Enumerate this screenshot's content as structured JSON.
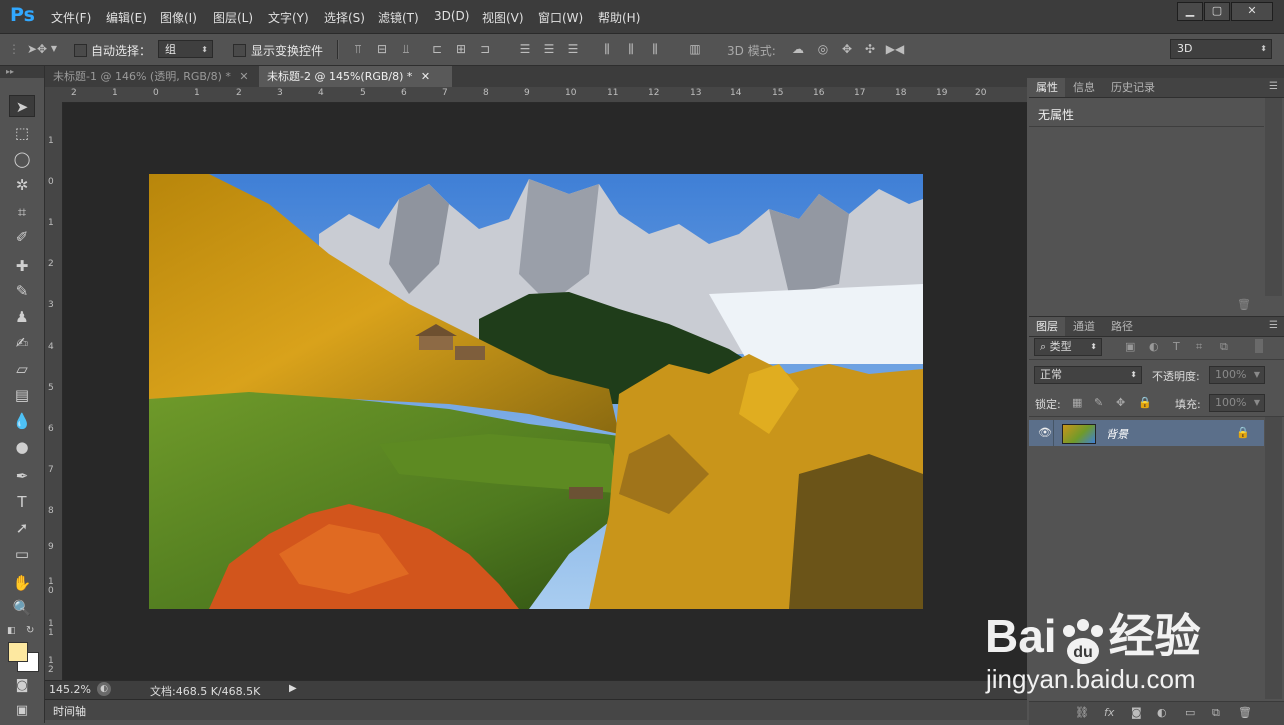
{
  "app": {
    "logo": "Ps",
    "menus": [
      "文件(F)",
      "编辑(E)",
      "图像(I)",
      "图层(L)",
      "文字(Y)",
      "选择(S)",
      "滤镜(T)",
      "3D(D)",
      "视图(V)",
      "窗口(W)",
      "帮助(H)"
    ],
    "window_controls": [
      "minimize-icon",
      "maximize-icon",
      "close-icon"
    ]
  },
  "options_bar": {
    "auto_select_label": "自动选择：",
    "auto_select_value": "组",
    "show_transform_label": "显示变换控件",
    "mode_3d_label": "3D 模式:",
    "workspace_value": "3D"
  },
  "tabs": [
    {
      "label": "未标题-1 @ 146% (透明, RGB/8) *",
      "active": false
    },
    {
      "label": "未标题-2 @ 145%(RGB/8) *",
      "active": true
    }
  ],
  "ruler_h": [
    "2",
    "1",
    "0",
    "1",
    "2",
    "3",
    "4",
    "5",
    "6",
    "7",
    "8",
    "9",
    "10",
    "11",
    "12",
    "13",
    "14",
    "15",
    "16",
    "17",
    "18",
    "19",
    "20"
  ],
  "ruler_v": [
    "1",
    "0",
    "1",
    "2",
    "3",
    "4",
    "5",
    "6",
    "7",
    "8",
    "9",
    "1\n0",
    "1\n1",
    "1\n2"
  ],
  "status": {
    "zoom": "145.2%",
    "doc_info": "文档:468.5 K/468.5K"
  },
  "timeline_label": "时间轴",
  "properties_panel": {
    "tabs": [
      "属性",
      "信息",
      "历史记录"
    ],
    "content": "无属性"
  },
  "layers_panel": {
    "tabs": [
      "图层",
      "通道",
      "路径"
    ],
    "filter_kind": "类型",
    "blend_mode": "正常",
    "opacity_label": "不透明度:",
    "opacity_value": "100%",
    "lock_label": "锁定:",
    "fill_label": "填充:",
    "fill_value": "100%",
    "layers": [
      {
        "name": "背景",
        "visible": true,
        "locked": true
      }
    ]
  },
  "watermark": {
    "brand_left": "Bai",
    "brand_right": "经验",
    "url": "jingyan.baidu.com"
  },
  "colors": {
    "foreground": "#fde8a0",
    "background": "#ffffff",
    "accent": "#31a8ff",
    "layer_selected": "#5b6f8a"
  }
}
